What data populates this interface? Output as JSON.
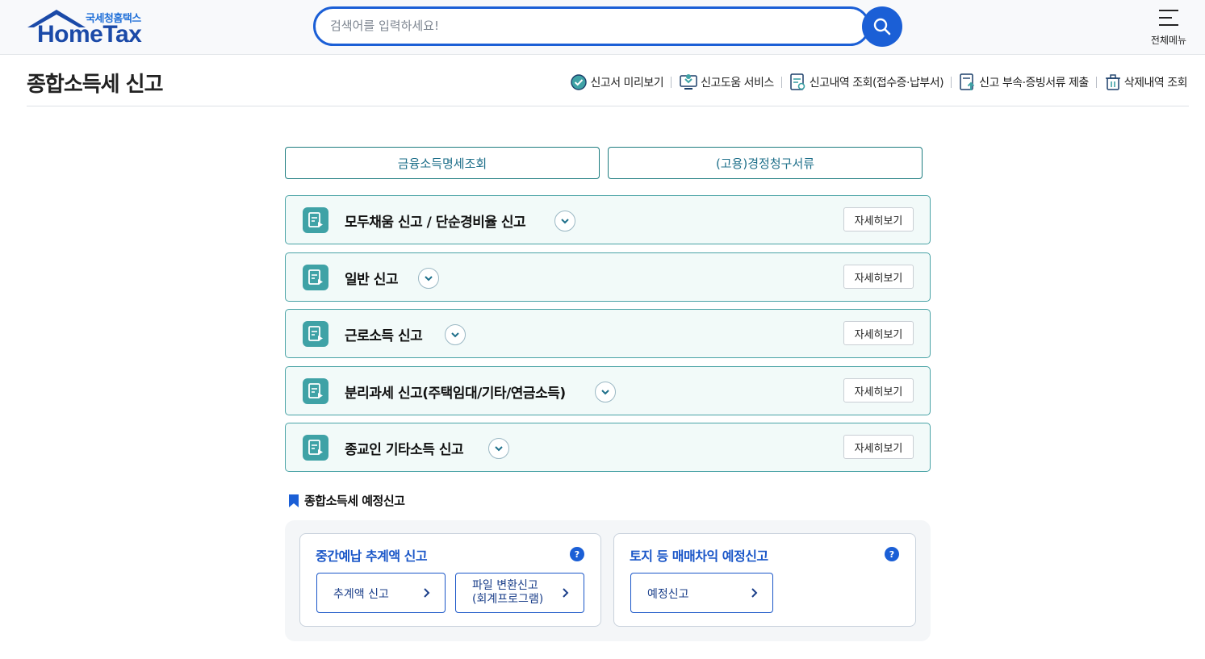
{
  "header": {
    "logo_sub": "국세청홈택스",
    "logo_main": "HomeTax",
    "search_placeholder": "검색어를 입력하세요!",
    "menu_label": "전체메뉴"
  },
  "page": {
    "title": "종합소득세 신고"
  },
  "quicklinks": [
    {
      "label": "신고서 미리보기",
      "icon": "check-badge-icon"
    },
    {
      "label": "신고도움 서비스",
      "icon": "monitor-help-icon"
    },
    {
      "label": "신고내역 조회(접수증·납부서)",
      "icon": "document-search-icon"
    },
    {
      "label": "신고 부속·증빙서류 제출",
      "icon": "document-upload-icon"
    },
    {
      "label": "삭제내역 조회",
      "icon": "trash-icon"
    }
  ],
  "top_buttons": [
    {
      "label": "금융소득명세조회"
    },
    {
      "label": "(고용)경정청구서류"
    }
  ],
  "accordion": [
    {
      "title": "모두채움 신고 / 단순경비율 신고",
      "detail": "자세히보기"
    },
    {
      "title": "일반 신고",
      "detail": "자세히보기"
    },
    {
      "title": "근로소득 신고",
      "detail": "자세히보기"
    },
    {
      "title": "분리과세 신고(주택임대/기타/연금소득)",
      "detail": "자세히보기"
    },
    {
      "title": "종교인 기타소득 신고",
      "detail": "자세히보기"
    }
  ],
  "estimate_section": {
    "heading": "종합소득세 예정신고",
    "cards": [
      {
        "title": "중간예납 추계액 신고",
        "help": "?",
        "buttons": [
          {
            "label": "추계액 신고"
          },
          {
            "label": "파일 변환신고\n(회계프로그램)"
          }
        ]
      },
      {
        "title": "토지 등 매매차익 예정신고",
        "help": "?",
        "buttons": [
          {
            "label": "예정신고"
          }
        ]
      }
    ]
  },
  "colors": {
    "brand_blue": "#1b5fd6",
    "teal": "#3fa2a6",
    "row_bg": "#f2faf9"
  }
}
